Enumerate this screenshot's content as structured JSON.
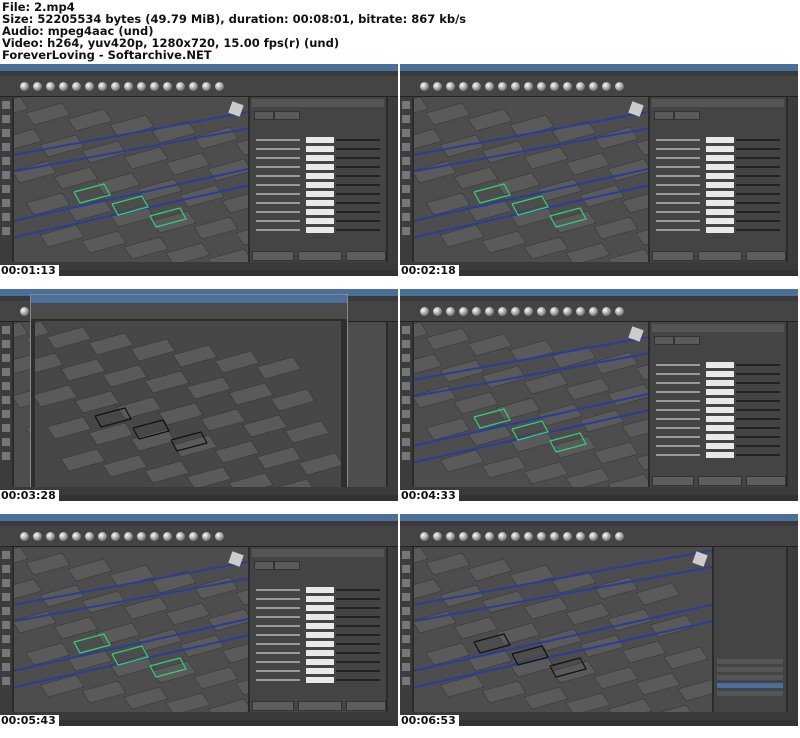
{
  "header": {
    "file": "File: 2.mp4",
    "size": "Size: 52205534 bytes (49.79 MiB), duration: 00:08:01, bitrate: 867 kb/s",
    "audio": "Audio: mpeg4aac (und)",
    "video": "Video: h264, yuv420p, 1280x720, 15.00 fps(r) (und)",
    "credit": "ForeverLoving - Softarchive.NET"
  },
  "thumbnails": [
    {
      "timestamp": "00:01:13",
      "kind": "attribute-editor",
      "lines_color": "#2fd27a"
    },
    {
      "timestamp": "00:02:18",
      "kind": "attribute-editor",
      "lines_color": "#2fd27a"
    },
    {
      "timestamp": "00:03:28",
      "kind": "render-view",
      "lines_color": "#111111"
    },
    {
      "timestamp": "00:04:33",
      "kind": "attribute-editor",
      "lines_color": "#2fd27a"
    },
    {
      "timestamp": "00:05:43",
      "kind": "attribute-editor",
      "lines_color": "#2fd27a"
    },
    {
      "timestamp": "00:06:53",
      "kind": "channel-box",
      "lines_color": "#111111"
    }
  ],
  "colors": {
    "maya_bg": "#444444",
    "viewport_bg": "#4d4d4d",
    "rail_blue": "#2a3d9a",
    "title_blue": "#4a6f9a"
  }
}
